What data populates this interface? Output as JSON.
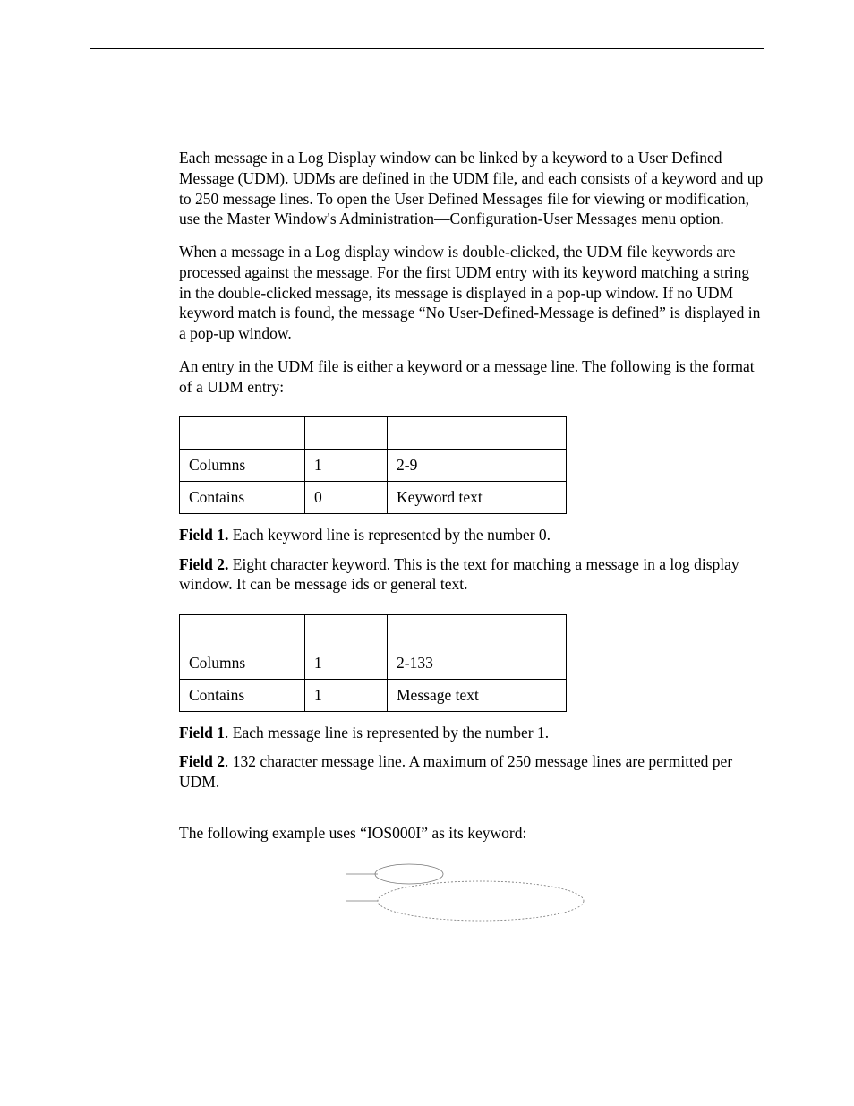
{
  "paragraphs": {
    "p1": "Each message in a Log Display window can be linked by a keyword to a User Defined Message (UDM). UDMs are defined in the UDM file, and each consists of a keyword and up to 250 message lines. To open the User Defined Messages file for viewing or modification, use the Master Window's Administration—Configuration-User Messages menu option.",
    "p2": "When a message in a Log display window is double-clicked, the UDM file keywords are processed against the message. For the first UDM entry with its keyword matching a string in the double-clicked message, its message is displayed in a pop-up window. If no UDM keyword match is found, the message “No User-Defined-Message is defined” is displayed in a pop-up window.",
    "p3": "An entry in the UDM file is either a keyword or a message line. The following is the format of a UDM entry:"
  },
  "table1": {
    "rows": [
      {
        "label": "Columns",
        "f1": "1",
        "f2": "2-9"
      },
      {
        "label": "Contains",
        "f1": "0",
        "f2": "Keyword text"
      }
    ]
  },
  "notes1": {
    "field1_label": "Field 1.",
    "field1_text": " Each keyword line is represented by the number 0.",
    "field2_label": "Field 2.",
    "field2_text": " Eight character keyword. This is the text for matching a message in a log display window. It can be message ids or general text."
  },
  "table2": {
    "rows": [
      {
        "label": "Columns",
        "f1": "1",
        "f2": "2-133"
      },
      {
        "label": "Contains",
        "f1": "1",
        "f2": "Message text"
      }
    ]
  },
  "notes2": {
    "field1_label": "Field 1",
    "field1_text": ". Each message line is represented by the number 1.",
    "field2_label": "Field 2",
    "field2_text": ". 132 character message line. A maximum of 250 message lines are permitted per UDM."
  },
  "example_lead": "The following example uses “IOS000I” as its keyword:"
}
